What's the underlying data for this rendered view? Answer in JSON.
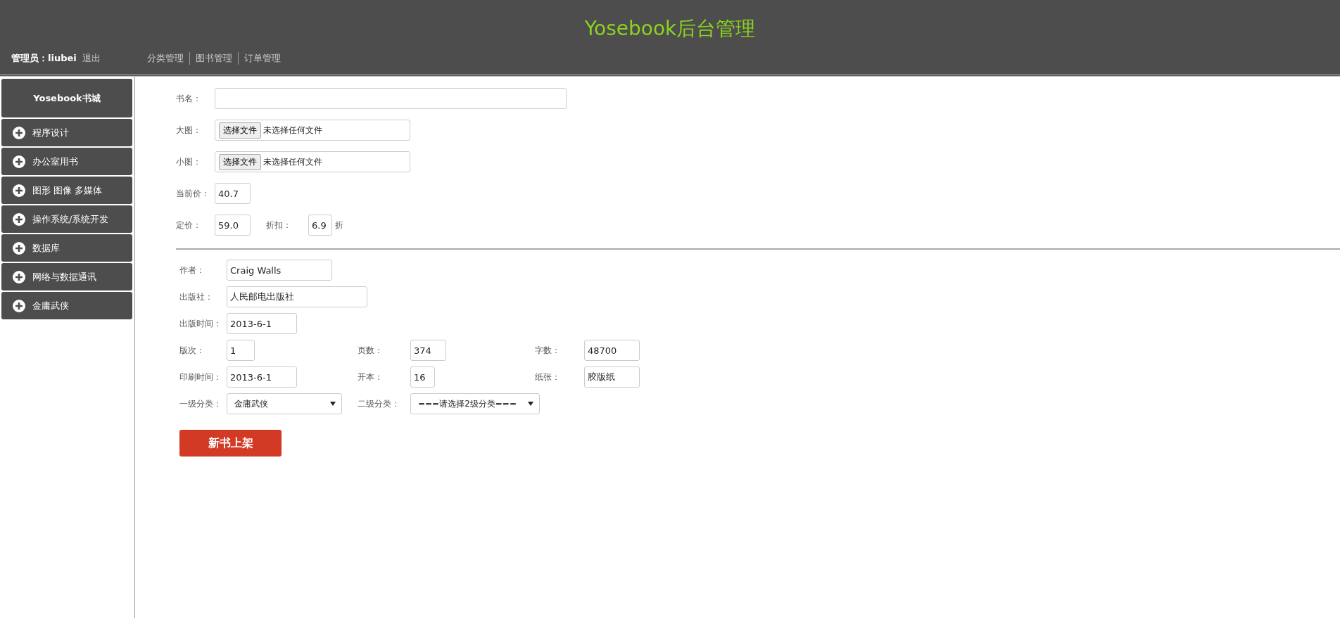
{
  "header": {
    "title": "Yosebook后台管理",
    "admin_label": "管理员：liubei",
    "logout": "退出",
    "nav": [
      "分类管理",
      "图书管理",
      "订单管理"
    ]
  },
  "sidebar": {
    "title": "Yosebook书城",
    "items": [
      "程序设计",
      "办公室用书",
      "图形 图像 多媒体",
      "操作系统/系统开发",
      "数据库",
      "网络与数据通讯",
      "金庸武侠"
    ]
  },
  "form": {
    "basic": [
      [
        {
          "label": "书名：",
          "kind": "text"
        }
      ],
      [
        {
          "label": "大图：",
          "kind": "file",
          "button": "选择文件",
          "status": "未选择任何文件"
        }
      ],
      [
        {
          "label": "小图：",
          "kind": "file",
          "button": "选择文件",
          "status": "未选择任何文件"
        }
      ],
      [
        {
          "label": "当前价：",
          "kind": "text",
          "value": "40.7"
        }
      ],
      [
        {
          "label": "定价：",
          "kind": "text",
          "value": "59.0"
        },
        {
          "label": "折扣：",
          "kind": "text",
          "value": "6.9",
          "suffix": "折"
        }
      ]
    ],
    "details": [
      [
        {
          "label": "作者：",
          "kind": "text",
          "value": "Craig Walls"
        }
      ],
      [
        {
          "label": "出版社：",
          "kind": "text",
          "value": "人民邮电出版社"
        }
      ],
      [
        {
          "label": "出版时间：",
          "kind": "text",
          "value": "2013-6-1"
        }
      ],
      [
        {
          "label": "版次：",
          "kind": "text",
          "value": "1"
        },
        {
          "label": "页数：",
          "kind": "text",
          "value": "374"
        },
        {
          "label": "字数：",
          "kind": "text",
          "value": "48700"
        }
      ],
      [
        {
          "label": "印刷时间：",
          "kind": "text",
          "value": "2013-6-1"
        },
        {
          "label": "开本：",
          "kind": "text",
          "value": "16"
        },
        {
          "label": "纸张：",
          "kind": "text",
          "value": "胶版纸"
        }
      ],
      [
        {
          "label": "一级分类：",
          "kind": "select",
          "value": "金庸武侠"
        },
        {
          "label": "二级分类：",
          "kind": "select",
          "value": "===请选择2级分类==="
        }
      ]
    ],
    "submit": "新书上架"
  }
}
